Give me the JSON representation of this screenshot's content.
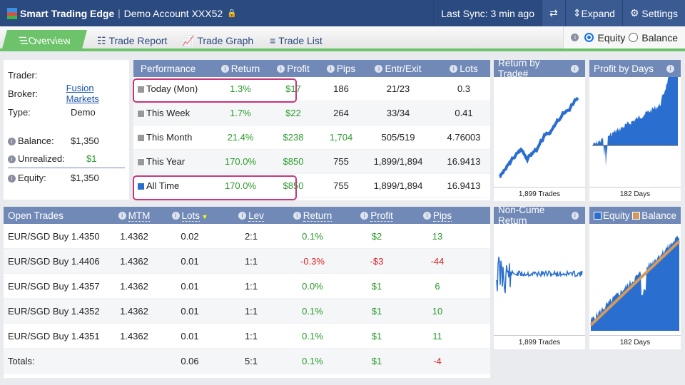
{
  "header": {
    "brand": "Smart Trading Edge",
    "separator": "|",
    "account": "Demo Account XXX52",
    "last_sync": "Last Sync: 3 min ago",
    "expand": "Expand",
    "settings": "Settings"
  },
  "tabs": [
    {
      "label": "Overview",
      "icon": "overview-icon"
    },
    {
      "label": "Trade Report",
      "icon": "list-icon"
    },
    {
      "label": "Trade Graph",
      "icon": "chart-icon"
    },
    {
      "label": "Trade List",
      "icon": "lines-icon"
    }
  ],
  "mode": {
    "options": [
      "Equity",
      "Balance"
    ],
    "selected": "Equity"
  },
  "account": {
    "trader_label": "Trader:",
    "trader": "",
    "broker_label": "Broker:",
    "broker": "Fusion Markets",
    "type_label": "Type:",
    "type": "Demo",
    "balance_label": "Balance:",
    "balance": "$1,350",
    "unrealized_label": "Unrealized:",
    "unrealized": "$1",
    "equity_label": "Equity:",
    "equity": "$1,350"
  },
  "performance": {
    "headers": [
      "Performance",
      "Return",
      "Profit",
      "Pips",
      "Entr/Exit",
      "Lots"
    ],
    "rows": [
      [
        "Today (Mon)",
        "1.3%",
        "$17",
        "186",
        "21/23",
        "0.3"
      ],
      [
        "This Week",
        "1.7%",
        "$22",
        "264",
        "33/34",
        "0.41"
      ],
      [
        "This Month",
        "21.4%",
        "$238",
        "1,704",
        "505/519",
        "4.76003"
      ],
      [
        "This Year",
        "170.0%",
        "$850",
        "755",
        "1,899/1,894",
        "16.9413"
      ],
      [
        "All Time",
        "170.0%",
        "$850",
        "755",
        "1,899/1,894",
        "16.9413"
      ]
    ]
  },
  "open_trades": {
    "headers": [
      "Open Trades",
      "MTM",
      "Lots",
      "Lev",
      "Return",
      "Profit",
      "Pips"
    ],
    "rows": [
      [
        "EUR/SGD Buy 1.4350",
        "1.4362",
        "0.02",
        "2:1",
        "0.1%",
        "$2",
        "13"
      ],
      [
        "EUR/SGD Buy 1.4406",
        "1.4362",
        "0.01",
        "1:1",
        "-0.3%",
        "-$3",
        "-44"
      ],
      [
        "EUR/SGD Buy 1.4357",
        "1.4362",
        "0.01",
        "1:1",
        "0.0%",
        "$1",
        "6"
      ],
      [
        "EUR/SGD Buy 1.4352",
        "1.4362",
        "0.01",
        "1:1",
        "0.1%",
        "$1",
        "10"
      ],
      [
        "EUR/SGD Buy 1.4351",
        "1.4362",
        "0.01",
        "1:1",
        "0.1%",
        "$1",
        "11"
      ]
    ],
    "totals": [
      "Totals:",
      "",
      "0.06",
      "5:1",
      "0.1%",
      "$1",
      "-4"
    ]
  },
  "charts": {
    "return_by_trade": {
      "title": "Return by Trade#",
      "caption": "1,899 Trades"
    },
    "profit_by_days": {
      "title": "Profit by Days",
      "caption": "182 Days"
    },
    "non_cume": {
      "title": "Non-Cume Return",
      "caption": "1,899 Trades"
    },
    "equity_balance": {
      "legend": [
        "Equity",
        "Balance"
      ],
      "caption": "182 Days"
    }
  },
  "colors": {
    "header": "#2b4a7f",
    "table_header": "#7189b7",
    "active_tab": "#6cc36a",
    "positive": "#2a9a2a",
    "negative": "#d22222",
    "highlight": "#c8367a",
    "equity": "#2a6fd0",
    "balance": "#d49a5c"
  }
}
